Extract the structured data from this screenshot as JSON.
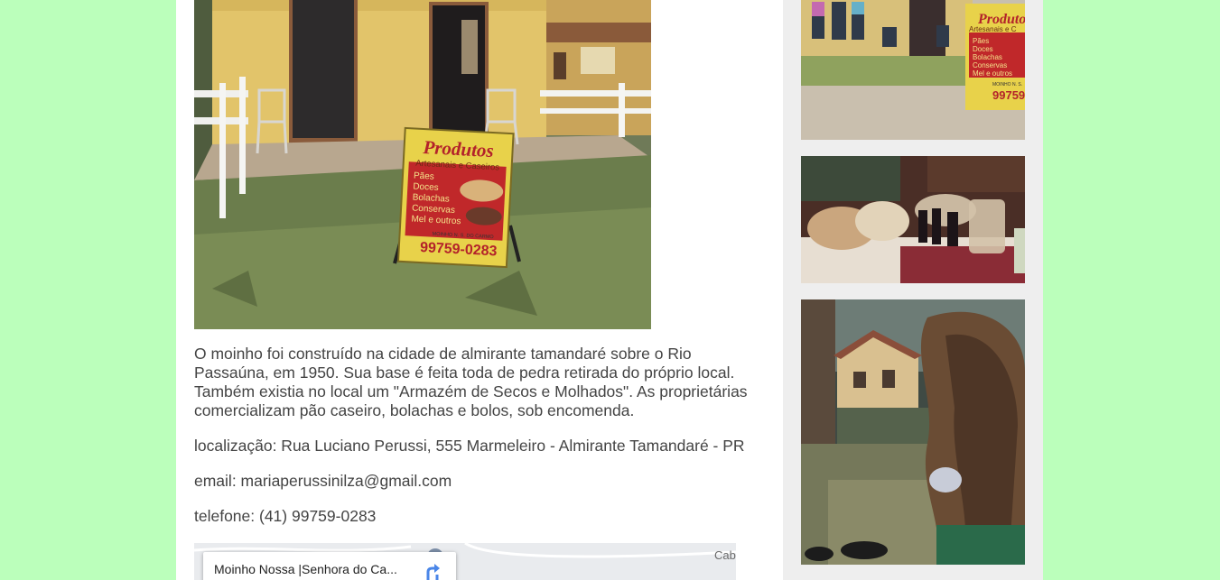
{
  "post": {
    "paragraph_1": "O moinho foi construído na cidade de almirante tamandaré sobre o Rio Passaúna, em 1950. Sua base é feita toda de pedra retirada do próprio local. Também existia no local um \"Armazém de Secos e Molhados\". As proprietárias comercializam pão caseiro, bolachas e bolos, sob encomenda.",
    "location": "localização: Rua Luciano Perussi, 555 Marmeleiro - Almirante Tamandaré - PR",
    "email": "email: mariaperussinilza@gmail.com",
    "phone": "telefone: (41) 99759-0283"
  },
  "photo_sign": {
    "title": "Produtos",
    "subtitle": "Artesanais e Caseiros",
    "items": [
      "Pães",
      "Doces",
      "Bolachas",
      "Conservas",
      "Mel e outros"
    ],
    "footer": "MOINHO N. S. DO CARMO",
    "phone": "99759-0283"
  },
  "sidebar_sign": {
    "title": "Produtos",
    "subtitle": "Artesanais e C",
    "items": [
      "Pães",
      "Doces",
      "Bolachas",
      "Conservas",
      "Mel e outros"
    ],
    "footer": "MOINHO N. S.",
    "phone": "99759"
  },
  "map": {
    "place_name": "Moinho Nossa |Senhora do Ca...",
    "town_label": "Cab",
    "icon": "directions-icon"
  },
  "colors": {
    "page_background": "#bbffbb",
    "content_background": "#ffffff",
    "sidebar_background": "#eeeeee",
    "text": "#444444",
    "sign_yellow": "#e8d24a",
    "sign_red": "#c0282a"
  }
}
